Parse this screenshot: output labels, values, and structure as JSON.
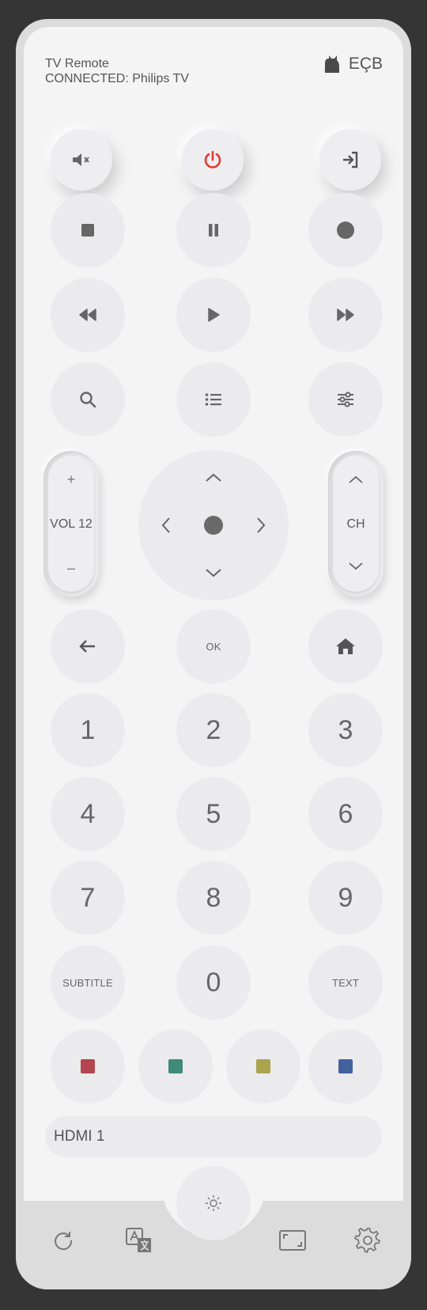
{
  "header": {
    "title": "TV Remote",
    "connection": "CONNECTED: Philips TV",
    "brand_text": "EÇB",
    "brand_icon": "cat-icon"
  },
  "top_row": [
    "mute-icon",
    "power-icon",
    "input-source-icon"
  ],
  "colors": {
    "power": "#e53935",
    "red": "#b4474d",
    "green": "#3f8a78",
    "yellow": "#aaa54d",
    "blue": "#44619e",
    "face": "#f4f4f5",
    "button": "#ebebed"
  },
  "volume": {
    "plus": "+",
    "label": "VOL 12",
    "minus": "–"
  },
  "channel": {
    "label": "CH"
  },
  "nav": {
    "ok": "OK"
  },
  "numbers": {
    "n1": "1",
    "n2": "2",
    "n3": "3",
    "n4": "4",
    "n5": "5",
    "n6": "6",
    "n7": "7",
    "n8": "8",
    "n9": "9",
    "n0": "0"
  },
  "labels": {
    "subtitle": "SUBTITLE",
    "text": "TEXT"
  },
  "input": {
    "current": "HDMI 1"
  },
  "bottom_bar": [
    "refresh-icon",
    "translate-icon",
    "aspect-ratio-icon",
    "settings-icon"
  ]
}
